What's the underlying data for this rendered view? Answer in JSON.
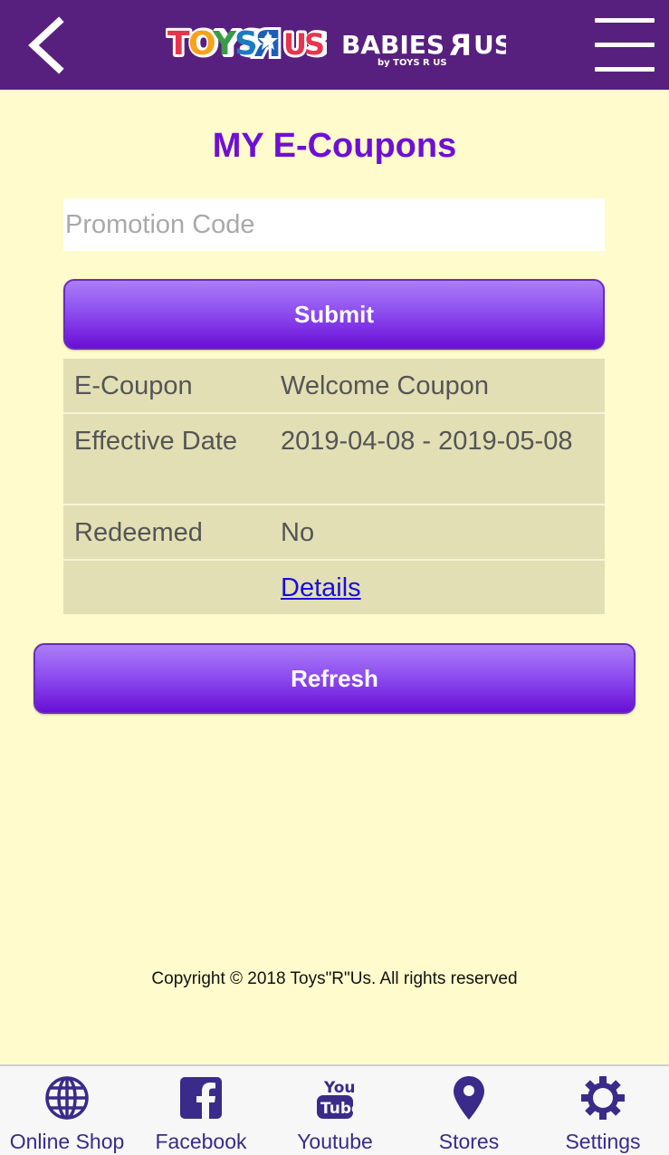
{
  "header": {
    "back_icon": "chevron-left-icon",
    "brand_primary": "TOYS R US",
    "brand_secondary": "BABIES R US",
    "brand_secondary_sub": "by TOYS R US",
    "menu_icon": "hamburger-icon",
    "background": "#57207e"
  },
  "page": {
    "title": "MY E-Coupons",
    "promo_placeholder": "Promotion Code",
    "submit_label": "Submit",
    "refresh_label": "Refresh",
    "copyright": "Copyright © 2018 Toys\"R\"Us. All rights reserved"
  },
  "coupon": {
    "rows": [
      {
        "label": "E-Coupon",
        "value": "Welcome Coupon"
      },
      {
        "label": "Effective Date",
        "value": "2019-04-08 - 2019-05-08"
      },
      {
        "label": "Redeemed",
        "value": "No"
      }
    ],
    "details_link": "Details"
  },
  "bottom_nav": [
    {
      "label": "Online Shop",
      "icon": "globe-icon"
    },
    {
      "label": "Facebook",
      "icon": "facebook-icon"
    },
    {
      "label": "Youtube",
      "icon": "youtube-icon"
    },
    {
      "label": "Stores",
      "icon": "map-pin-icon"
    },
    {
      "label": "Settings",
      "icon": "gear-icon"
    }
  ],
  "colors": {
    "accent": "#6f0fd6",
    "page_bg": "#fffbcc",
    "table_bg": "#e2dfb5",
    "nav_icon": "#3a2b8a"
  }
}
